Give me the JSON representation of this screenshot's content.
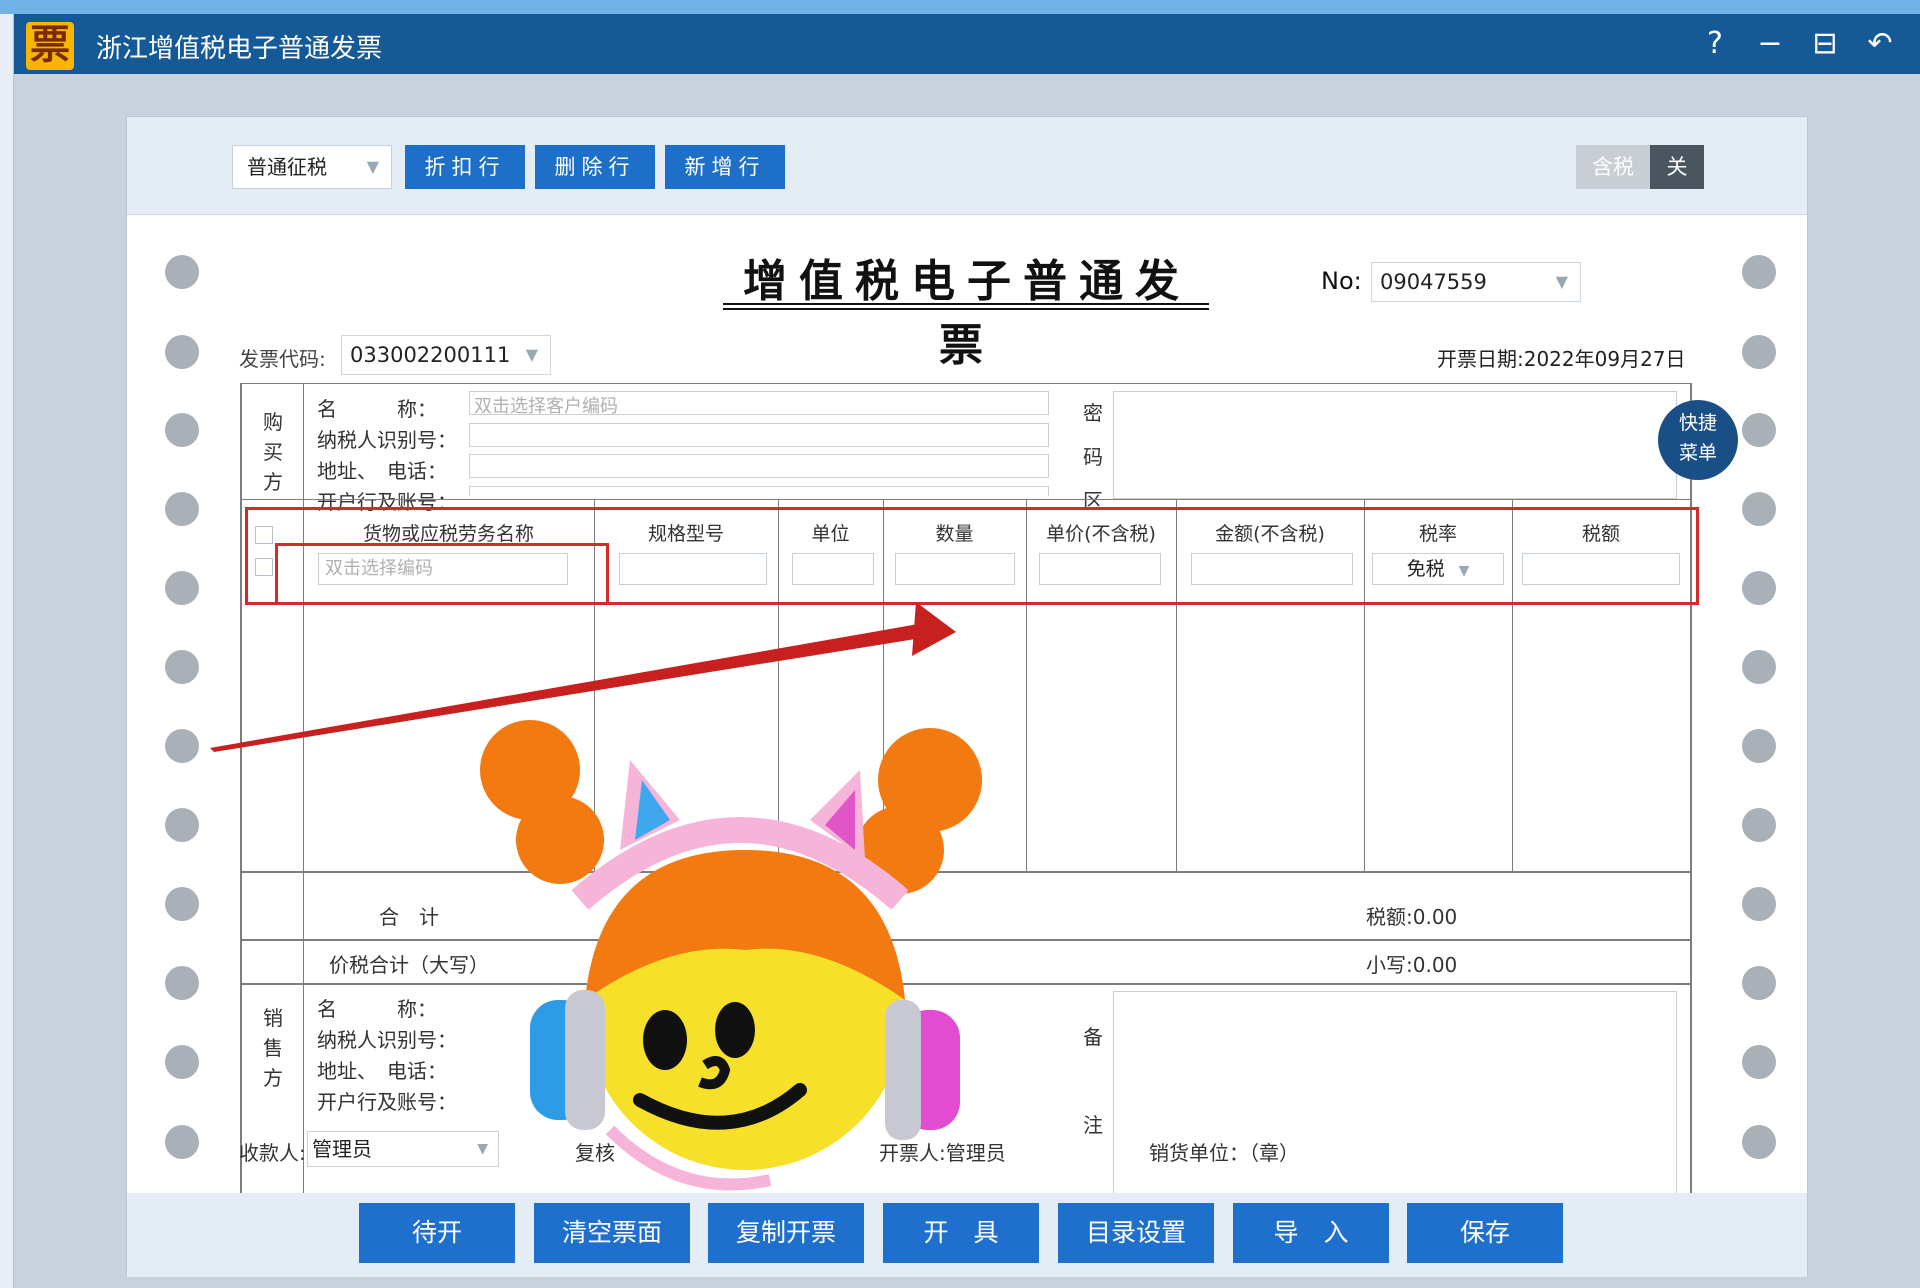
{
  "window": {
    "title": "浙江增值税电子普通发票",
    "icon_glyph": "票",
    "help_glyph": "?",
    "minimize_glyph": "−",
    "maximize_glyph": "⊟",
    "back_glyph": "↶"
  },
  "toolbar": {
    "tax_type": "普通征税",
    "discount_row": "折扣行",
    "delete_row": "删除行",
    "add_row": "新增行",
    "incl_tax": "含税",
    "toggle_off": "关"
  },
  "invoice": {
    "title": "增值税电子普通发票",
    "no_label": "No:",
    "no_value": "09047559",
    "code_label": "发票代码:",
    "code_value": "033002200111",
    "date_text": "开票日期:2022年09月27日",
    "buyer": {
      "side_label": [
        "购",
        "买",
        "方"
      ],
      "name_label": "名　　　称：",
      "name_placeholder": "双击选择客户编码",
      "taxid_label": "纳税人识别号：",
      "addr_label": "地址、　电话：",
      "bank_label": "开户行及账号："
    },
    "cipher_label": [
      "密",
      "码",
      "区"
    ],
    "items_header": {
      "name": "货物或应税劳务名称",
      "spec": "规格型号",
      "unit": "单位",
      "qty": "数量",
      "price": "单价(不含税)",
      "amount": "金额(不含税)",
      "rate": "税率",
      "tax": "税额"
    },
    "item_row": {
      "name_placeholder": "双击选择编码",
      "rate_value": "免税"
    },
    "total_label": "合　计",
    "tax_total": "税额:0.00",
    "grand_label": "价税合计（大写）",
    "small_total": "小写:0.00",
    "seller": {
      "side_label": [
        "销",
        "售",
        "方"
      ],
      "name_label": "名　　　称：",
      "taxid_label": "纳税人识别号：",
      "addr_label": "地址、　电话：",
      "bank_label": "开户行及账号："
    },
    "remark_label": [
      "备",
      "注"
    ],
    "payee_label": "收款人:",
    "payee_value": "管理员",
    "reviewer_label": "复核",
    "drawer_text": "开票人:管理员",
    "seller_stamp": "销货单位：（章）"
  },
  "quick_menu": [
    "快捷",
    "菜单"
  ],
  "bottom": {
    "pending": "待开",
    "clear": "清空票面",
    "copy": "复制开票",
    "issue": "开　具",
    "catalog": "目录设置",
    "import": "导　入",
    "save": "保存"
  },
  "colors": {
    "titlebar": "#155a96",
    "button": "#1f70cc",
    "annotation_red": "#d42a2a"
  }
}
